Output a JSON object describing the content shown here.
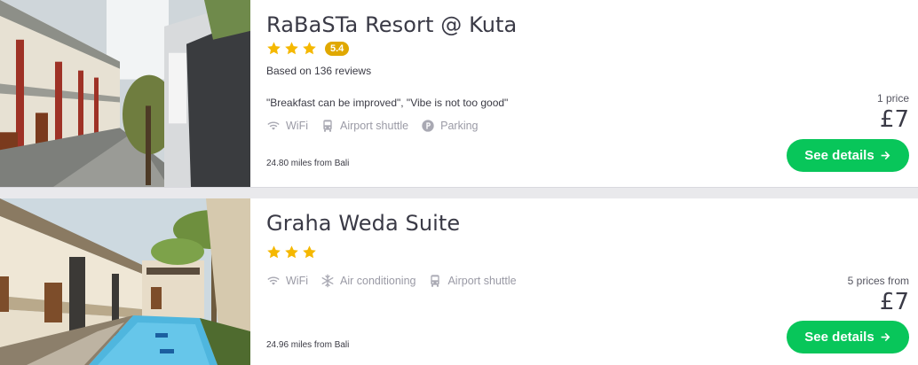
{
  "hotels": [
    {
      "name": "RaBaSTa Resort @ Kuta",
      "stars": 3,
      "rating": "5.4",
      "reviews": "Based on 136 reviews",
      "quote": "\"Breakfast can be improved\", \"Vibe is not too good\"",
      "amenities": [
        {
          "icon": "wifi-icon",
          "label": "WiFi"
        },
        {
          "icon": "shuttle-icon",
          "label": "Airport shuttle"
        },
        {
          "icon": "parking-icon",
          "label": "Parking"
        }
      ],
      "distance": "24.80 miles from Bali",
      "price_label": "1 price",
      "price": "£7",
      "button": "See details"
    },
    {
      "name": "Graha Weda Suite",
      "stars": 3,
      "amenities": [
        {
          "icon": "wifi-icon",
          "label": "WiFi"
        },
        {
          "icon": "snowflake-icon",
          "label": "Air conditioning"
        },
        {
          "icon": "shuttle-icon",
          "label": "Airport shuttle"
        }
      ],
      "distance": "24.96 miles from Bali",
      "price_label": "5 prices from",
      "price": "£7",
      "button": "See details"
    }
  ],
  "colors": {
    "star": "#f5b800",
    "rating_badge": "#e0a800",
    "button": "#08c65a",
    "amenity": "#9a9aa5"
  }
}
